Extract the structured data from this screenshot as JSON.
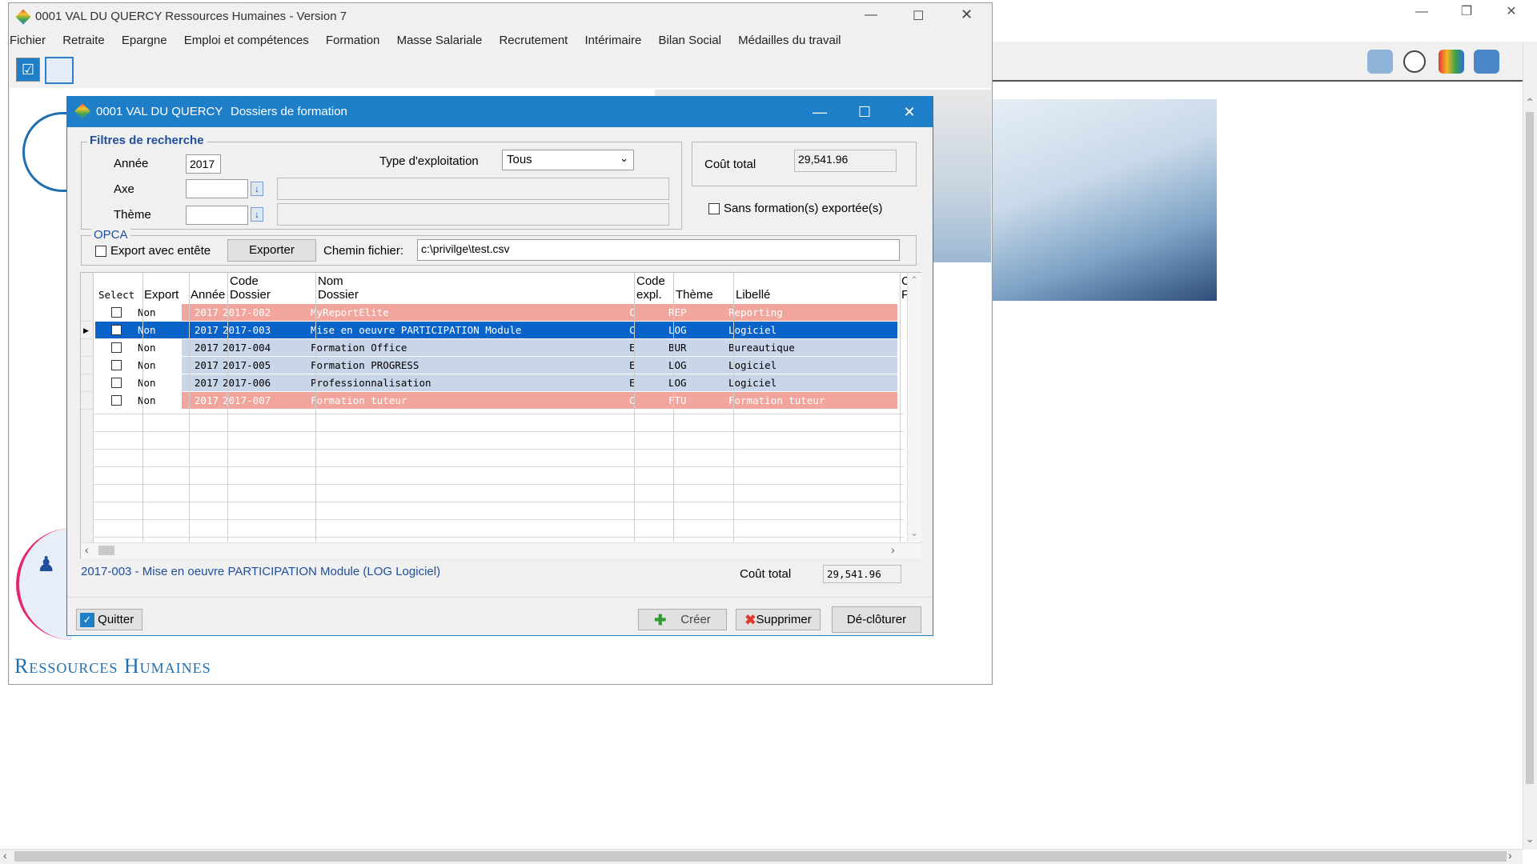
{
  "app": {
    "title": "0001  VAL DU QUERCY  Ressources Humaines - Version 7",
    "menu": [
      "Fichier",
      "Retraite",
      "Epargne",
      "Emploi et compétences",
      "Formation",
      "Masse Salariale",
      "Recrutement",
      "Intérimaire",
      "Bilan Social",
      "Médailles du travail"
    ],
    "section_title": "Ressources Humaines"
  },
  "dialog": {
    "company": "0001  VAL DU QUERCY",
    "title": "Dossiers de formation",
    "filters": {
      "legend": "Filtres de recherche",
      "annee_label": "Année",
      "annee_value": "2017",
      "axe_label": "Axe",
      "axe_value": "",
      "theme_label": "Thème",
      "theme_value": "",
      "type_label": "Type d'exploitation",
      "type_value": "Tous"
    },
    "cout_total_label": "Coût total",
    "cout_total_value": "29,541.96",
    "sans_formation_label": "Sans formation(s) exportée(s)",
    "opca": {
      "legend": "OPCA",
      "export_entete_label": "Export avec entête",
      "export_button": "Exporter",
      "chemin_label": "Chemin fichier:",
      "chemin_value": "c:\\privilge\\test.csv"
    },
    "grid": {
      "headers": {
        "select": "Select",
        "export": "Export",
        "annee": "Année",
        "code_l1": "Code",
        "code_l2": "Dossier",
        "nom_l1": "Nom",
        "nom_l2": "Dossier",
        "expl_l1": "Code",
        "expl_l2": "expl.",
        "theme": "Thème",
        "libelle": "Libellé",
        "extra_l1": "C",
        "extra_l2": "F"
      },
      "rows": [
        {
          "export": "Non",
          "annee": "2017",
          "code": "2017-002",
          "nom": "MyReportElite",
          "expl": "C",
          "theme": "REP",
          "libelle": "Reporting",
          "style": "red"
        },
        {
          "export": "Non",
          "annee": "2017",
          "code": "2017-003",
          "nom": "Mise en oeuvre PARTICIPATION Module",
          "expl": "C",
          "theme": "LOG",
          "libelle": "Logiciel",
          "style": "selected"
        },
        {
          "export": "Non",
          "annee": "2017",
          "code": "2017-004",
          "nom": "Formation Office",
          "expl": "E",
          "theme": "BUR",
          "libelle": "Bureautique",
          "style": "blue"
        },
        {
          "export": "Non",
          "annee": "2017",
          "code": "2017-005",
          "nom": "Formation PROGRESS",
          "expl": "E",
          "theme": "LOG",
          "libelle": "Logiciel",
          "style": "blue"
        },
        {
          "export": "Non",
          "annee": "2017",
          "code": "2017-006",
          "nom": "Professionnalisation",
          "expl": "E",
          "theme": "LOG",
          "libelle": "Logiciel",
          "style": "blue"
        },
        {
          "export": "Non",
          "annee": "2017",
          "code": "2017-007",
          "nom": "Formation tuteur",
          "expl": "C",
          "theme": "FTU",
          "libelle": "Formation tuteur",
          "style": "red"
        }
      ]
    },
    "status_text": "2017-003 - Mise en oeuvre PARTICIPATION Module  (LOG  Logiciel)",
    "footer_cout_label": "Coût total",
    "footer_cout_value": "29,541.96",
    "buttons": {
      "quitter": "Quitter",
      "creer": "Créer",
      "supprimer": "Supprimer",
      "decloturer": "Dé-clôturer"
    }
  },
  "colors": {
    "dialog_blue": "#1e7fc8",
    "row_red": "#f2a59c",
    "row_blue": "#c9d5e8",
    "row_selected": "#0a63c8"
  }
}
